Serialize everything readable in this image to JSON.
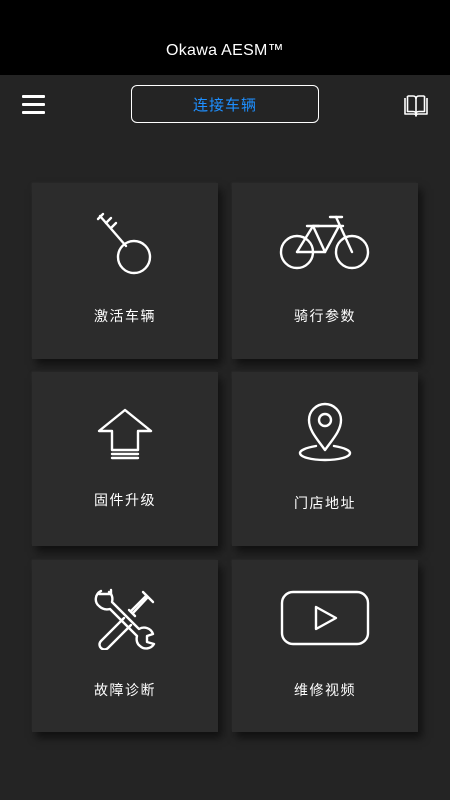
{
  "header": {
    "title": "Okawa AESM™"
  },
  "toolbar": {
    "menu_icon": "hamburger-menu-icon",
    "connect_label": "连接车辆",
    "connect_color": "#1e8fff",
    "manual_icon": "book-icon"
  },
  "tiles": [
    {
      "label": "激活车辆",
      "icon": "key-icon"
    },
    {
      "label": "骑行参数",
      "icon": "bicycle-icon"
    },
    {
      "label": "固件升级",
      "icon": "upgrade-arrow-icon"
    },
    {
      "label": "门店地址",
      "icon": "location-pin-icon"
    },
    {
      "label": "故障诊断",
      "icon": "tools-icon"
    },
    {
      "label": "维修视频",
      "icon": "video-play-icon"
    }
  ],
  "colors": {
    "background": "#242424",
    "tile": "#2c2c2c",
    "title_bar": "#000000",
    "text": "#ffffff"
  }
}
